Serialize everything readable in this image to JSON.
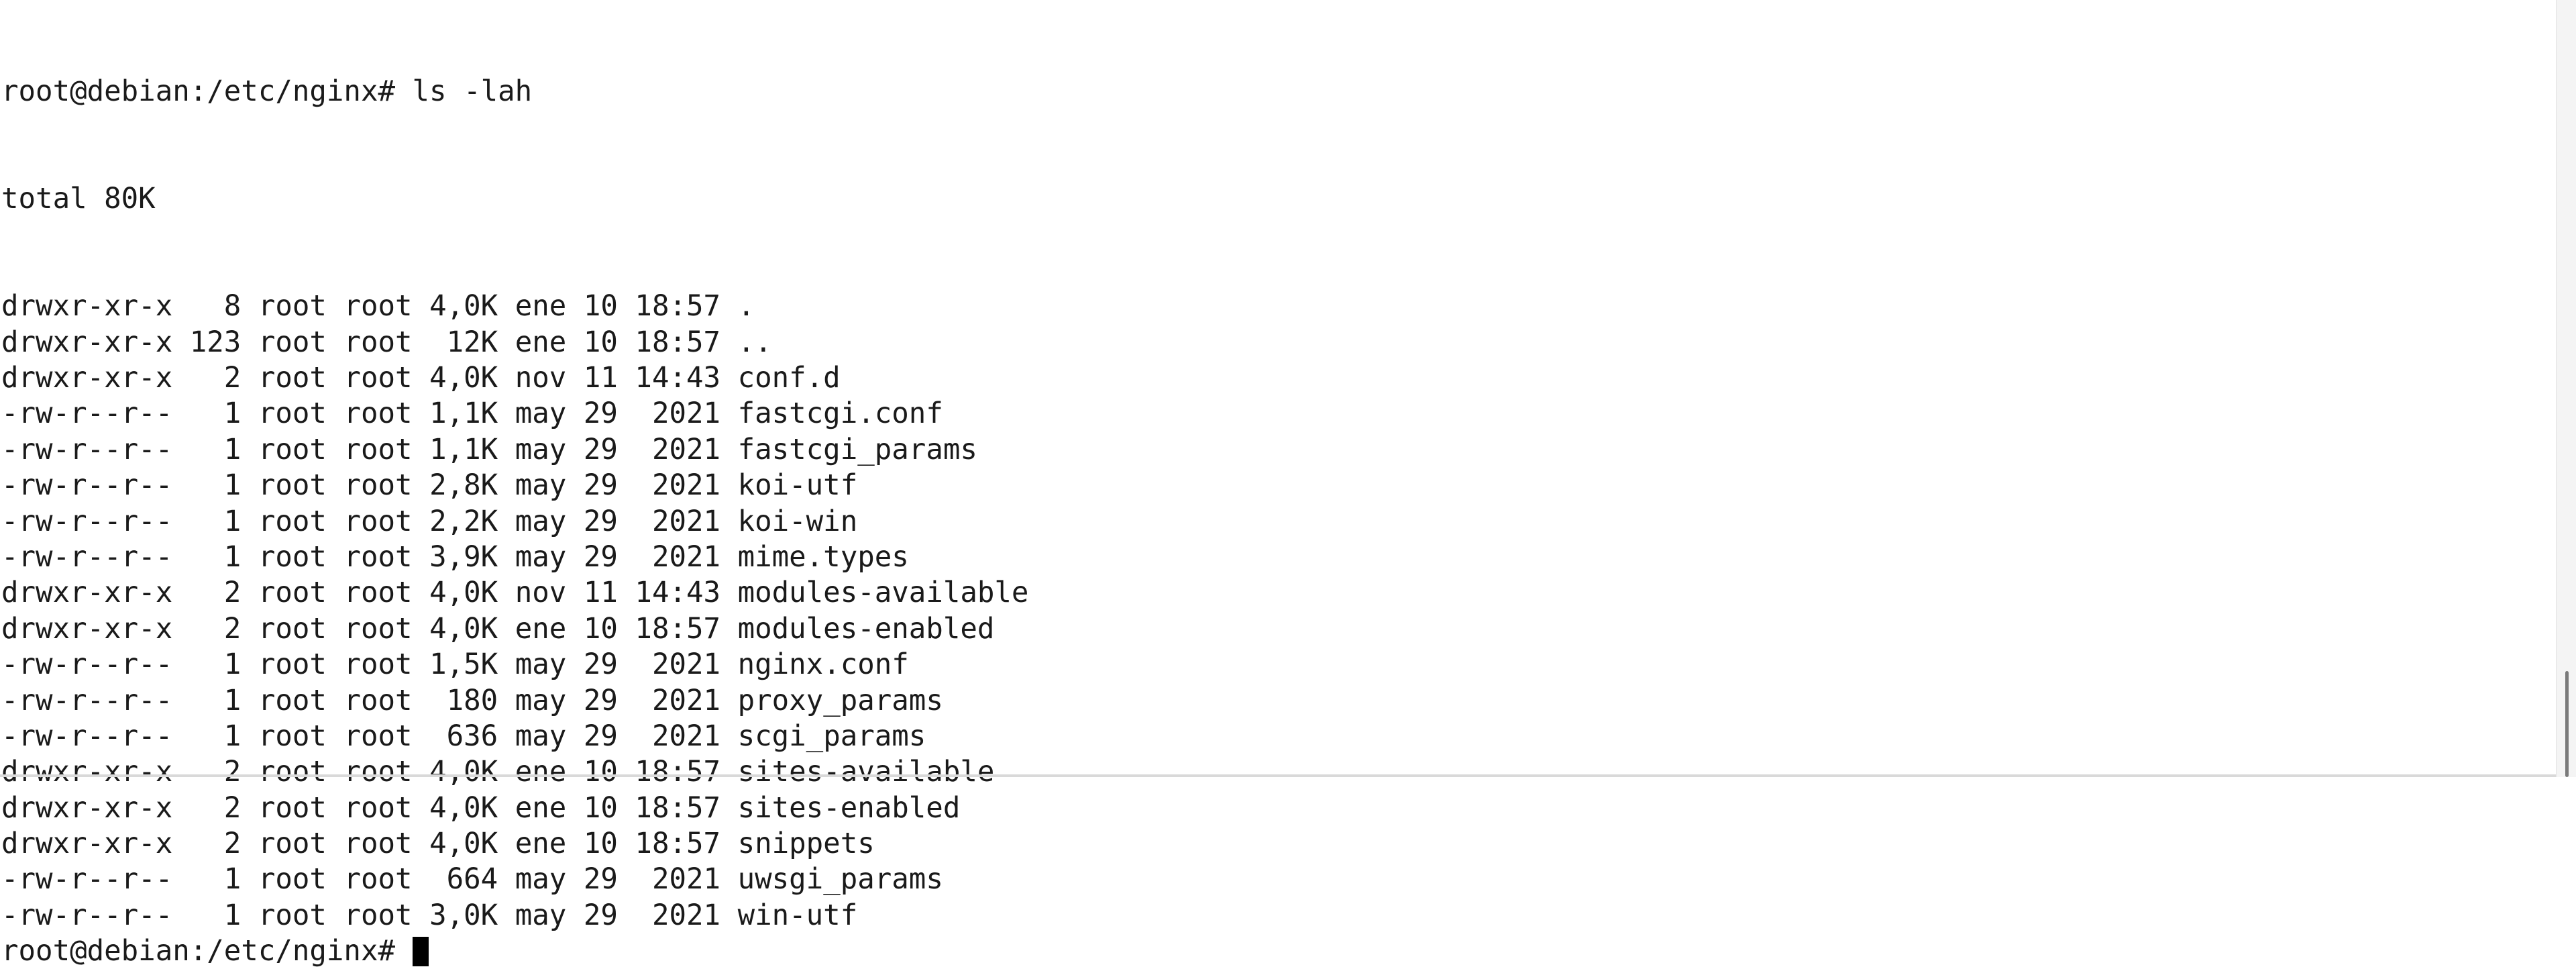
{
  "terminal": {
    "prompt": "root@debian:/etc/nginx# ",
    "command": "ls -lah",
    "total_line": "total 80K",
    "rows": [
      {
        "perms": "drwxr-xr-x",
        "links": "8",
        "owner": "root",
        "group": "root",
        "size": "4,0K",
        "month": "ene",
        "day": "10",
        "time": "18:57",
        "name": "."
      },
      {
        "perms": "drwxr-xr-x",
        "links": "123",
        "owner": "root",
        "group": "root",
        "size": "12K",
        "month": "ene",
        "day": "10",
        "time": "18:57",
        "name": ".."
      },
      {
        "perms": "drwxr-xr-x",
        "links": "2",
        "owner": "root",
        "group": "root",
        "size": "4,0K",
        "month": "nov",
        "day": "11",
        "time": "14:43",
        "name": "conf.d"
      },
      {
        "perms": "-rw-r--r--",
        "links": "1",
        "owner": "root",
        "group": "root",
        "size": "1,1K",
        "month": "may",
        "day": "29",
        "time": "2021",
        "name": "fastcgi.conf"
      },
      {
        "perms": "-rw-r--r--",
        "links": "1",
        "owner": "root",
        "group": "root",
        "size": "1,1K",
        "month": "may",
        "day": "29",
        "time": "2021",
        "name": "fastcgi_params"
      },
      {
        "perms": "-rw-r--r--",
        "links": "1",
        "owner": "root",
        "group": "root",
        "size": "2,8K",
        "month": "may",
        "day": "29",
        "time": "2021",
        "name": "koi-utf"
      },
      {
        "perms": "-rw-r--r--",
        "links": "1",
        "owner": "root",
        "group": "root",
        "size": "2,2K",
        "month": "may",
        "day": "29",
        "time": "2021",
        "name": "koi-win"
      },
      {
        "perms": "-rw-r--r--",
        "links": "1",
        "owner": "root",
        "group": "root",
        "size": "3,9K",
        "month": "may",
        "day": "29",
        "time": "2021",
        "name": "mime.types"
      },
      {
        "perms": "drwxr-xr-x",
        "links": "2",
        "owner": "root",
        "group": "root",
        "size": "4,0K",
        "month": "nov",
        "day": "11",
        "time": "14:43",
        "name": "modules-available"
      },
      {
        "perms": "drwxr-xr-x",
        "links": "2",
        "owner": "root",
        "group": "root",
        "size": "4,0K",
        "month": "ene",
        "day": "10",
        "time": "18:57",
        "name": "modules-enabled"
      },
      {
        "perms": "-rw-r--r--",
        "links": "1",
        "owner": "root",
        "group": "root",
        "size": "1,5K",
        "month": "may",
        "day": "29",
        "time": "2021",
        "name": "nginx.conf"
      },
      {
        "perms": "-rw-r--r--",
        "links": "1",
        "owner": "root",
        "group": "root",
        "size": "180",
        "month": "may",
        "day": "29",
        "time": "2021",
        "name": "proxy_params"
      },
      {
        "perms": "-rw-r--r--",
        "links": "1",
        "owner": "root",
        "group": "root",
        "size": "636",
        "month": "may",
        "day": "29",
        "time": "2021",
        "name": "scgi_params"
      },
      {
        "perms": "drwxr-xr-x",
        "links": "2",
        "owner": "root",
        "group": "root",
        "size": "4,0K",
        "month": "ene",
        "day": "10",
        "time": "18:57",
        "name": "sites-available"
      },
      {
        "perms": "drwxr-xr-x",
        "links": "2",
        "owner": "root",
        "group": "root",
        "size": "4,0K",
        "month": "ene",
        "day": "10",
        "time": "18:57",
        "name": "sites-enabled"
      },
      {
        "perms": "drwxr-xr-x",
        "links": "2",
        "owner": "root",
        "group": "root",
        "size": "4,0K",
        "month": "ene",
        "day": "10",
        "time": "18:57",
        "name": "snippets"
      },
      {
        "perms": "-rw-r--r--",
        "links": "1",
        "owner": "root",
        "group": "root",
        "size": "664",
        "month": "may",
        "day": "29",
        "time": "2021",
        "name": "uwsgi_params"
      },
      {
        "perms": "-rw-r--r--",
        "links": "1",
        "owner": "root",
        "group": "root",
        "size": "3,0K",
        "month": "may",
        "day": "29",
        "time": "2021",
        "name": "win-utf"
      }
    ]
  },
  "colors": {
    "background": "#ffffff",
    "foreground": "#1a1a1a",
    "cursor": "#000000"
  }
}
